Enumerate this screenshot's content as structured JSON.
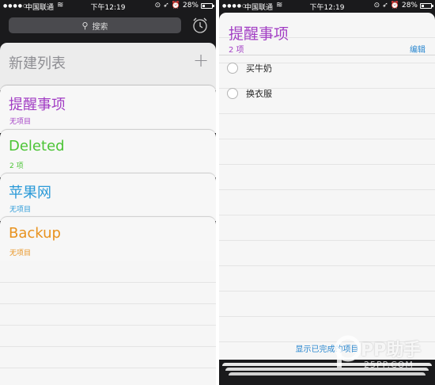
{
  "status": {
    "carrier": "中国联通",
    "time": "下午12:19",
    "battery": "28%"
  },
  "left": {
    "search_label": "搜索",
    "new_list_label": "新建列表",
    "lists": [
      {
        "name": "提醒事项",
        "sub": "无项目",
        "color": "#a23ec4"
      },
      {
        "name": "Deleted",
        "sub": "2 项",
        "color": "#4cc436"
      },
      {
        "name": "苹果网",
        "sub": "无项目",
        "color": "#2a9ad8"
      },
      {
        "name": "Backup",
        "sub": "无项目",
        "color": "#e8921e"
      }
    ]
  },
  "right": {
    "title": "提醒事项",
    "count": "2 项",
    "edit_label": "编辑",
    "items": [
      {
        "label": "买牛奶"
      },
      {
        "label": "换衣服"
      }
    ],
    "show_completed": "显示已完成的项目"
  },
  "watermark": {
    "main": "PP助手",
    "sub": "25PP.COM"
  },
  "colors": {
    "accent_purple": "#a23ec4",
    "link_blue": "#2a87cf"
  }
}
